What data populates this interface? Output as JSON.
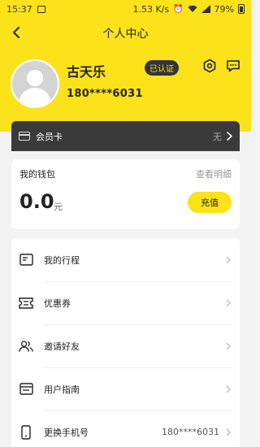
{
  "status_bar": {
    "time": "15:37",
    "speed": "1.53 K/s",
    "battery": "79%"
  },
  "nav": {
    "title": "个人中心"
  },
  "profile": {
    "name": "古天乐",
    "phone": "180****6031",
    "verified_badge": "已认证"
  },
  "member_card": {
    "label": "会员卡",
    "value": "无"
  },
  "wallet": {
    "title": "我的钱包",
    "detail_link": "查看明细",
    "amount": "0.0",
    "unit": "元",
    "recharge_button": "充值"
  },
  "menu": [
    {
      "label": "我的行程",
      "icon": "trip-icon",
      "value": ""
    },
    {
      "label": "优惠券",
      "icon": "coupon-icon",
      "value": ""
    },
    {
      "label": "邀请好友",
      "icon": "invite-friends-icon",
      "value": ""
    },
    {
      "label": "用户指南",
      "icon": "guide-icon",
      "value": ""
    },
    {
      "label": "更换手机号",
      "icon": "phone-icon",
      "value": "180****6031"
    }
  ],
  "colors": {
    "brand_yellow": "#fbe21a",
    "dark": "#333333"
  }
}
